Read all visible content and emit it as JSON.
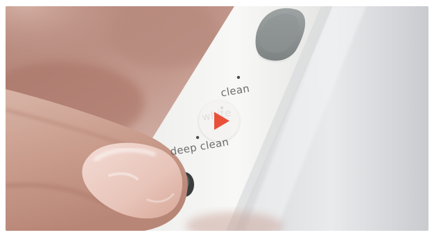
{
  "device": {
    "mode_labels": {
      "clean": "clean",
      "white": "white",
      "deep_clean": "deep clean"
    }
  },
  "player": {
    "play_icon": "play-icon",
    "accent_color": "#e8503a"
  }
}
